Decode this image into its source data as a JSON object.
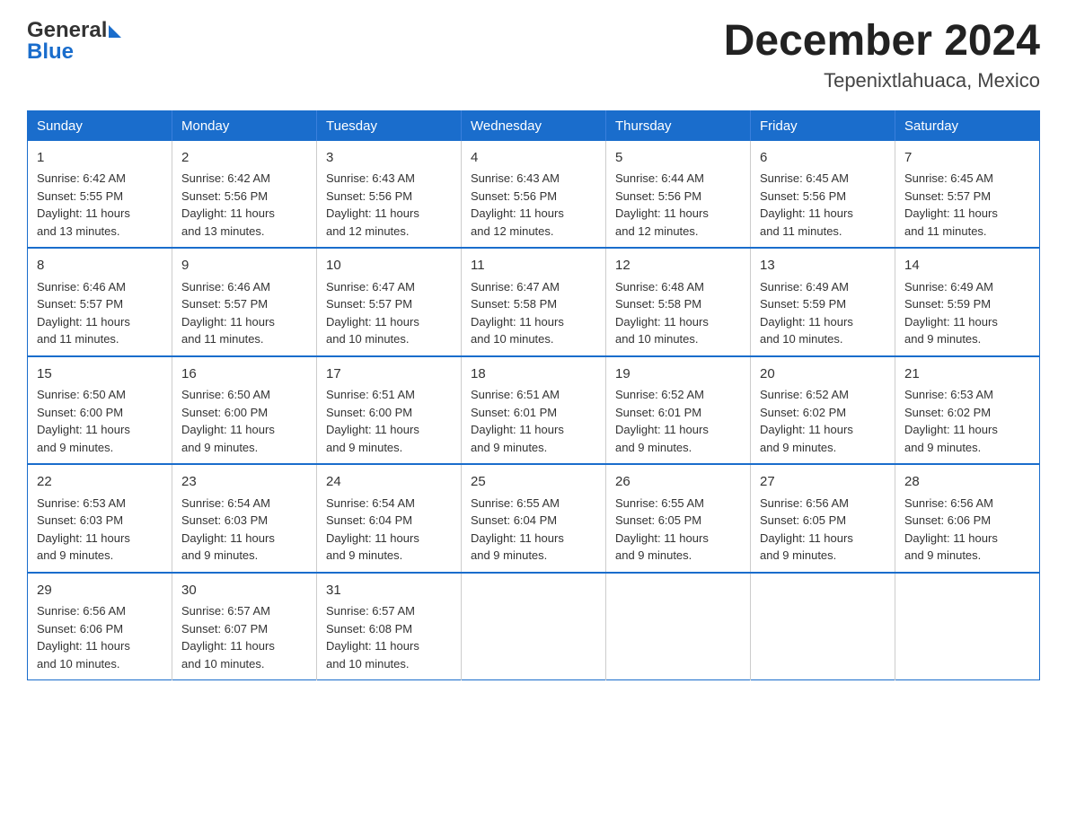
{
  "header": {
    "logo_general": "General",
    "logo_arrow": "▶",
    "logo_blue": "Blue",
    "month_title": "December 2024",
    "location": "Tepenixtlahuaca, Mexico"
  },
  "weekdays": [
    "Sunday",
    "Monday",
    "Tuesday",
    "Wednesday",
    "Thursday",
    "Friday",
    "Saturday"
  ],
  "weeks": [
    [
      {
        "day": "1",
        "sunrise": "6:42 AM",
        "sunset": "5:55 PM",
        "daylight": "11 hours and 13 minutes."
      },
      {
        "day": "2",
        "sunrise": "6:42 AM",
        "sunset": "5:56 PM",
        "daylight": "11 hours and 13 minutes."
      },
      {
        "day": "3",
        "sunrise": "6:43 AM",
        "sunset": "5:56 PM",
        "daylight": "11 hours and 12 minutes."
      },
      {
        "day": "4",
        "sunrise": "6:43 AM",
        "sunset": "5:56 PM",
        "daylight": "11 hours and 12 minutes."
      },
      {
        "day": "5",
        "sunrise": "6:44 AM",
        "sunset": "5:56 PM",
        "daylight": "11 hours and 12 minutes."
      },
      {
        "day": "6",
        "sunrise": "6:45 AM",
        "sunset": "5:56 PM",
        "daylight": "11 hours and 11 minutes."
      },
      {
        "day": "7",
        "sunrise": "6:45 AM",
        "sunset": "5:57 PM",
        "daylight": "11 hours and 11 minutes."
      }
    ],
    [
      {
        "day": "8",
        "sunrise": "6:46 AM",
        "sunset": "5:57 PM",
        "daylight": "11 hours and 11 minutes."
      },
      {
        "day": "9",
        "sunrise": "6:46 AM",
        "sunset": "5:57 PM",
        "daylight": "11 hours and 11 minutes."
      },
      {
        "day": "10",
        "sunrise": "6:47 AM",
        "sunset": "5:57 PM",
        "daylight": "11 hours and 10 minutes."
      },
      {
        "day": "11",
        "sunrise": "6:47 AM",
        "sunset": "5:58 PM",
        "daylight": "11 hours and 10 minutes."
      },
      {
        "day": "12",
        "sunrise": "6:48 AM",
        "sunset": "5:58 PM",
        "daylight": "11 hours and 10 minutes."
      },
      {
        "day": "13",
        "sunrise": "6:49 AM",
        "sunset": "5:59 PM",
        "daylight": "11 hours and 10 minutes."
      },
      {
        "day": "14",
        "sunrise": "6:49 AM",
        "sunset": "5:59 PM",
        "daylight": "11 hours and 9 minutes."
      }
    ],
    [
      {
        "day": "15",
        "sunrise": "6:50 AM",
        "sunset": "6:00 PM",
        "daylight": "11 hours and 9 minutes."
      },
      {
        "day": "16",
        "sunrise": "6:50 AM",
        "sunset": "6:00 PM",
        "daylight": "11 hours and 9 minutes."
      },
      {
        "day": "17",
        "sunrise": "6:51 AM",
        "sunset": "6:00 PM",
        "daylight": "11 hours and 9 minutes."
      },
      {
        "day": "18",
        "sunrise": "6:51 AM",
        "sunset": "6:01 PM",
        "daylight": "11 hours and 9 minutes."
      },
      {
        "day": "19",
        "sunrise": "6:52 AM",
        "sunset": "6:01 PM",
        "daylight": "11 hours and 9 minutes."
      },
      {
        "day": "20",
        "sunrise": "6:52 AM",
        "sunset": "6:02 PM",
        "daylight": "11 hours and 9 minutes."
      },
      {
        "day": "21",
        "sunrise": "6:53 AM",
        "sunset": "6:02 PM",
        "daylight": "11 hours and 9 minutes."
      }
    ],
    [
      {
        "day": "22",
        "sunrise": "6:53 AM",
        "sunset": "6:03 PM",
        "daylight": "11 hours and 9 minutes."
      },
      {
        "day": "23",
        "sunrise": "6:54 AM",
        "sunset": "6:03 PM",
        "daylight": "11 hours and 9 minutes."
      },
      {
        "day": "24",
        "sunrise": "6:54 AM",
        "sunset": "6:04 PM",
        "daylight": "11 hours and 9 minutes."
      },
      {
        "day": "25",
        "sunrise": "6:55 AM",
        "sunset": "6:04 PM",
        "daylight": "11 hours and 9 minutes."
      },
      {
        "day": "26",
        "sunrise": "6:55 AM",
        "sunset": "6:05 PM",
        "daylight": "11 hours and 9 minutes."
      },
      {
        "day": "27",
        "sunrise": "6:56 AM",
        "sunset": "6:05 PM",
        "daylight": "11 hours and 9 minutes."
      },
      {
        "day": "28",
        "sunrise": "6:56 AM",
        "sunset": "6:06 PM",
        "daylight": "11 hours and 9 minutes."
      }
    ],
    [
      {
        "day": "29",
        "sunrise": "6:56 AM",
        "sunset": "6:06 PM",
        "daylight": "11 hours and 10 minutes."
      },
      {
        "day": "30",
        "sunrise": "6:57 AM",
        "sunset": "6:07 PM",
        "daylight": "11 hours and 10 minutes."
      },
      {
        "day": "31",
        "sunrise": "6:57 AM",
        "sunset": "6:08 PM",
        "daylight": "11 hours and 10 minutes."
      },
      null,
      null,
      null,
      null
    ]
  ],
  "labels": {
    "sunrise": "Sunrise:",
    "sunset": "Sunset:",
    "daylight": "Daylight:"
  }
}
